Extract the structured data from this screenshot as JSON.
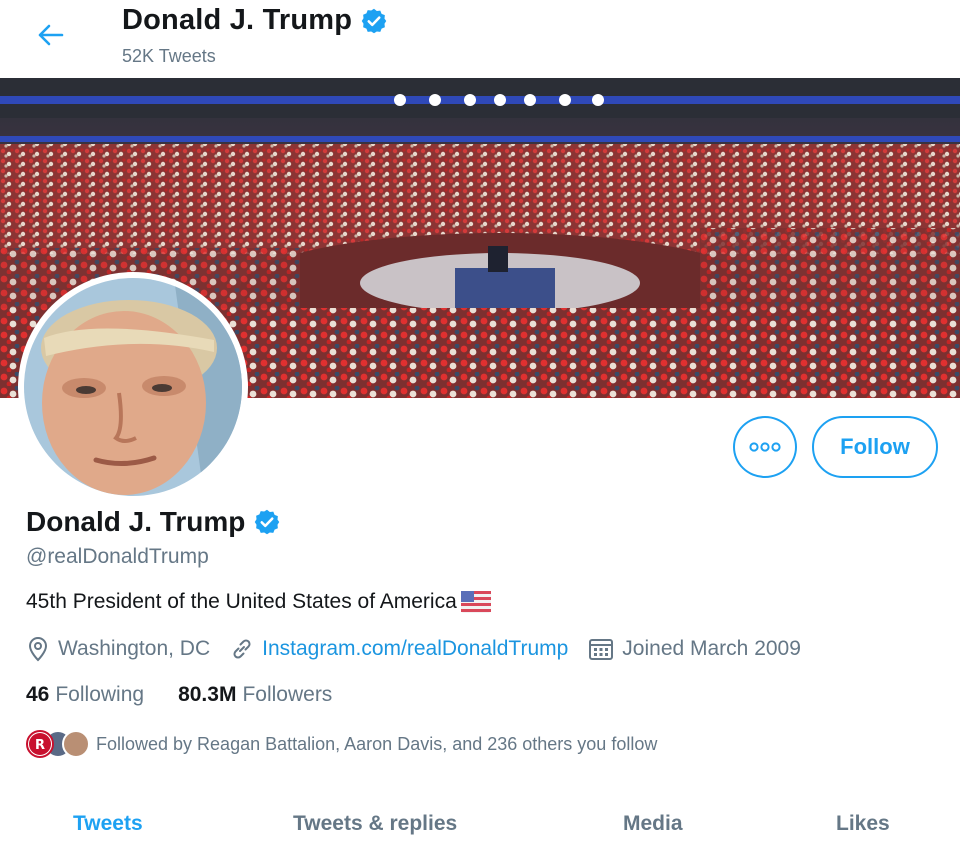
{
  "header": {
    "name": "Donald J. Trump",
    "tweet_count": "52K Tweets"
  },
  "actions": {
    "follow_label": "Follow"
  },
  "profile": {
    "name": "Donald J. Trump",
    "handle": "@realDonaldTrump",
    "bio": "45th President of the United States of America",
    "location": "Washington, DC",
    "website": "Instagram.com/realDonaldTrump",
    "joined": "Joined March 2009"
  },
  "stats": {
    "following_count": "46",
    "following_label": "Following",
    "followers_count": "80.3M",
    "followers_label": "Followers"
  },
  "followed_by": "Followed by Reagan Battalion, Aaron Davis, and 236 others you follow",
  "tabs": [
    {
      "label": "Tweets",
      "active": true
    },
    {
      "label": "Tweets & replies",
      "active": false
    },
    {
      "label": "Media",
      "active": false
    },
    {
      "label": "Likes",
      "active": false
    }
  ],
  "icons": {
    "back": "arrow-left-icon",
    "verified": "verified-badge-icon",
    "more": "more-dots-icon",
    "location": "location-pin-icon",
    "link": "link-icon",
    "calendar": "calendar-icon"
  },
  "colors": {
    "accent": "#1da1f2",
    "link": "#1b95e0",
    "muted": "#657786",
    "text": "#14171a"
  }
}
